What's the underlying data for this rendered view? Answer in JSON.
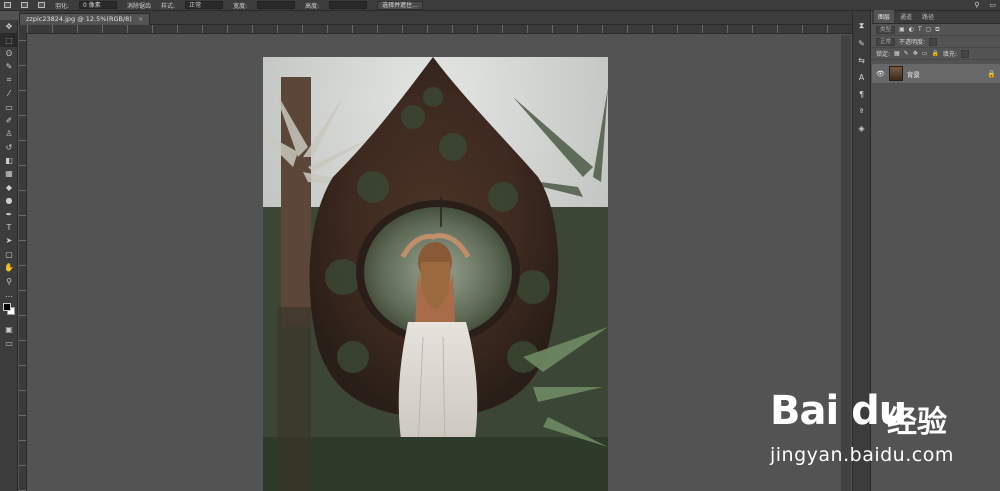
{
  "options_bar": {
    "feather_label": "羽化:",
    "feather_value": "0 像素",
    "antialias_label": "消除锯齿",
    "style_label": "样式:",
    "style_value": "正常",
    "width_label": "宽度:",
    "height_label": "高度:",
    "select_mask_button": "选择并遮住..."
  },
  "document_tab": {
    "title": "zzpic23824.jpg @ 12.5%(RGB/8)",
    "close": "×"
  },
  "tools": [
    {
      "name": "move-tool",
      "glyph": "✥"
    },
    {
      "name": "marquee-tool",
      "glyph": "⬚"
    },
    {
      "name": "lasso-tool",
      "glyph": "ʘ"
    },
    {
      "name": "quick-select-tool",
      "glyph": "✎"
    },
    {
      "name": "crop-tool",
      "glyph": "⌗"
    },
    {
      "name": "eyedropper-tool",
      "glyph": "⁄"
    },
    {
      "name": "frame-tool",
      "glyph": "▭"
    },
    {
      "name": "brush-tool",
      "glyph": "✐"
    },
    {
      "name": "stamp-tool",
      "glyph": "♙"
    },
    {
      "name": "history-brush-tool",
      "glyph": "↺"
    },
    {
      "name": "eraser-tool",
      "glyph": "◧"
    },
    {
      "name": "gradient-tool",
      "glyph": "▦"
    },
    {
      "name": "blur-tool",
      "glyph": "◆"
    },
    {
      "name": "dodge-tool",
      "glyph": "●"
    },
    {
      "name": "pen-tool",
      "glyph": "✒"
    },
    {
      "name": "type-tool",
      "glyph": "T"
    },
    {
      "name": "path-select-tool",
      "glyph": "➤"
    },
    {
      "name": "shape-tool",
      "glyph": "▢"
    },
    {
      "name": "hand-tool",
      "glyph": "✋"
    },
    {
      "name": "zoom-tool",
      "glyph": "⚲"
    },
    {
      "name": "more-tools",
      "glyph": "…"
    }
  ],
  "right_strip": [
    {
      "name": "history-icon",
      "glyph": "⧗"
    },
    {
      "name": "brush-settings-icon",
      "glyph": "✎"
    },
    {
      "name": "adjust-icon",
      "glyph": "⇆"
    },
    {
      "name": "character-icon",
      "glyph": "A"
    },
    {
      "name": "paragraph-icon",
      "glyph": "¶"
    },
    {
      "name": "glyphs-icon",
      "glyph": "ª"
    },
    {
      "name": "3d-icon",
      "glyph": "◈"
    }
  ],
  "panel": {
    "tabs": [
      "图层",
      "通道",
      "路径"
    ],
    "kind_label": "类型",
    "blend_mode": "正常",
    "opacity_label": "不透明度:",
    "lock_label": "锁定:",
    "fill_label": "填充:",
    "layer_name": "背景",
    "eye": "👁",
    "lock": "🔒"
  },
  "watermark": {
    "logo": "Bai  du",
    "zh": "经验",
    "url": "jingyan.baidu.com"
  },
  "colors": {
    "ui_dark": "#3c3c3c",
    "canvas_bg": "#535353",
    "foreground": "#000000",
    "background": "#ffffff"
  }
}
